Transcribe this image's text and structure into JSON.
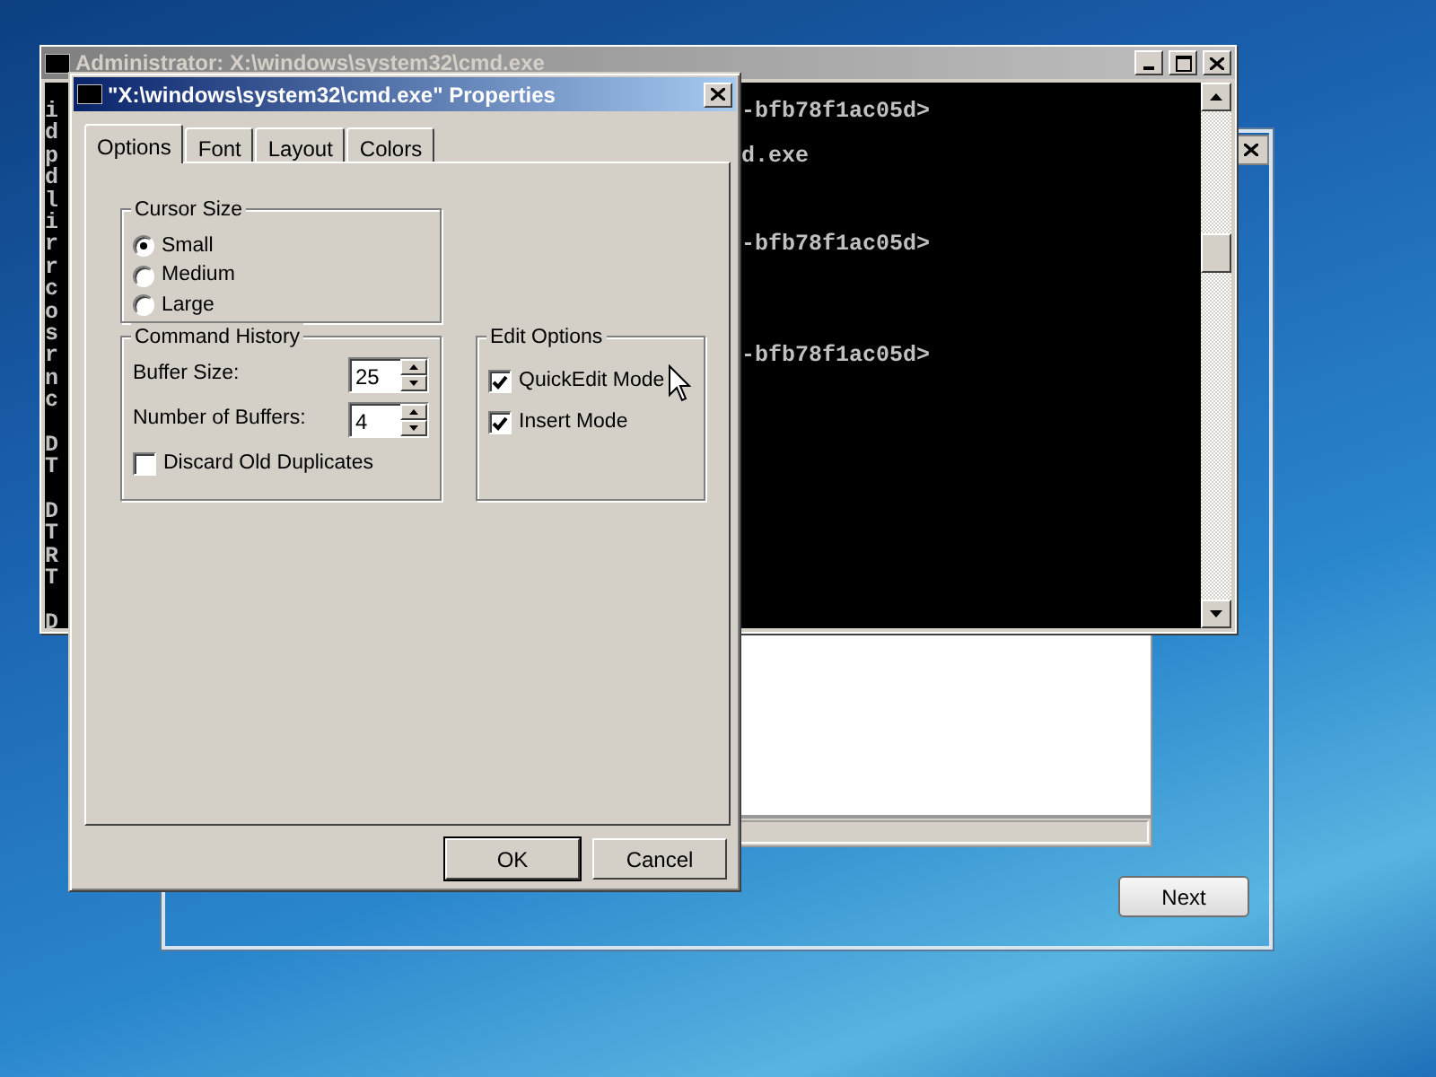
{
  "setup_window": {
    "next_button": "Next"
  },
  "console_window": {
    "title": "Administrator: X:\\windows\\system32\\cmd.exe",
    "blocks": [
      [
        {
          "left": "i",
          "right": "-bfb78f1ac05d>"
        },
        {
          "left": "d"
        },
        {
          "left": "p",
          "right": "d.exe"
        },
        {
          "left": "d"
        },
        {
          "left": "l"
        },
        {
          "left": "i"
        },
        {
          "left": "r",
          "right": "-bfb78f1ac05d>"
        },
        {
          "left": "r"
        },
        {
          "left": "c"
        },
        {
          "left": "o"
        },
        {
          "left": "s"
        },
        {
          "left": "r",
          "right": "-bfb78f1ac05d>"
        },
        {
          "left": "n"
        },
        {
          "left": "c"
        }
      ],
      [
        {
          "left": "D"
        },
        {
          "left": "T"
        }
      ],
      [
        {
          "left": "D"
        },
        {
          "left": "T"
        },
        {
          "left": "R"
        },
        {
          "left": "T"
        }
      ],
      [
        {
          "left": "D"
        }
      ]
    ]
  },
  "properties_dialog": {
    "title": "\"X:\\windows\\system32\\cmd.exe\" Properties",
    "tabs": [
      {
        "label": "Options",
        "selected": true
      },
      {
        "label": "Font",
        "selected": false
      },
      {
        "label": "Layout",
        "selected": false
      },
      {
        "label": "Colors",
        "selected": false
      }
    ],
    "cursor_size": {
      "label": "Cursor Size",
      "options": [
        {
          "label": "Small",
          "selected": true
        },
        {
          "label": "Medium",
          "selected": false
        },
        {
          "label": "Large",
          "selected": false
        }
      ]
    },
    "command_history": {
      "label": "Command History",
      "fields": [
        {
          "label": "Buffer Size:",
          "value": "25"
        },
        {
          "label": "Number of Buffers:",
          "value": "4"
        }
      ],
      "discard_old_duplicates": {
        "label": "Discard Old Duplicates",
        "checked": false
      }
    },
    "edit_options": {
      "label": "Edit Options",
      "options": [
        {
          "label": "QuickEdit Mode",
          "checked": true
        },
        {
          "label": "Insert Mode",
          "checked": true
        }
      ]
    },
    "buttons": [
      {
        "label": "OK",
        "default": true
      },
      {
        "label": "Cancel",
        "default": false
      }
    ]
  }
}
